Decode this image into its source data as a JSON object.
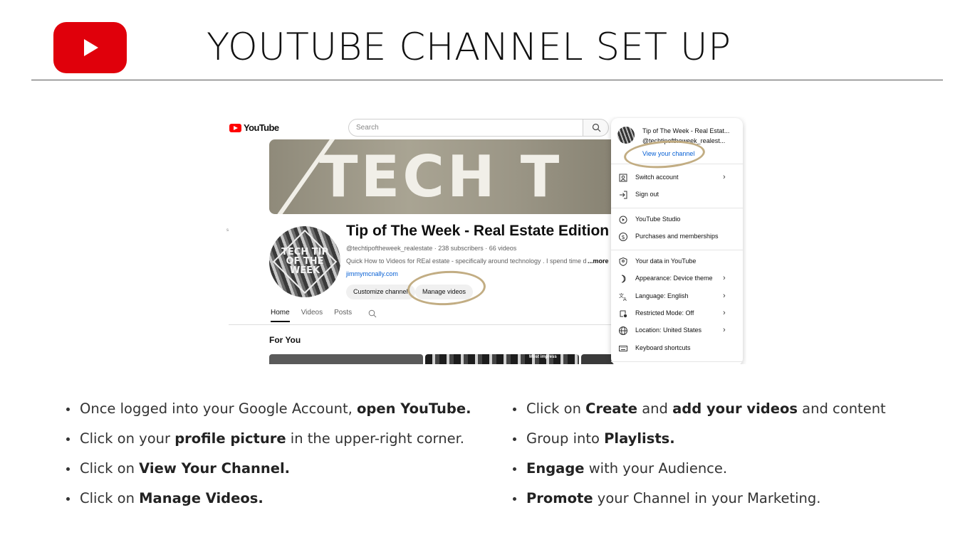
{
  "slide": {
    "title": "YOUTUBE CHANNEL SET UP",
    "logo_icon": "youtube-play-icon",
    "accent_color": "#e0000b"
  },
  "screenshot": {
    "brand": "YouTube",
    "search_placeholder": "Search",
    "banner_text": "TECH T",
    "avatar_text": [
      "TECH TIP",
      "OF THE",
      "WEEK"
    ],
    "channel": {
      "name": "Tip of The Week - Real Estate Edition",
      "meta": "@techtipoftheweek_realestate · 238 subscribers · 66 videos",
      "description": "Quick How to Videos for REal estate - specifically around technology . I spend time disc",
      "more": "...more",
      "link": "jimmymcnally.com",
      "customize_label": "Customize channel",
      "manage_label": "Manage videos"
    },
    "tabs": [
      "Home",
      "Videos",
      "Posts"
    ],
    "section_title": "For You",
    "thumb_caption": "Most impress",
    "stray_mark": "s",
    "menu": {
      "account_name": "Tip of The Week - Real Estat...",
      "account_handle": "@techtipoftheweek_realest...",
      "view_channel": "View your channel",
      "items": [
        {
          "label": "Switch account",
          "icon": "switch-account-icon",
          "chevron": true
        },
        {
          "label": "Sign out",
          "icon": "sign-out-icon",
          "chevron": false
        },
        {
          "label": "YouTube Studio",
          "icon": "studio-icon",
          "chevron": false
        },
        {
          "label": "Purchases and memberships",
          "icon": "dollar-icon",
          "chevron": false
        },
        {
          "label": "Your data in YouTube",
          "icon": "shield-icon",
          "chevron": false
        },
        {
          "label": "Appearance: Device theme",
          "icon": "moon-icon",
          "chevron": true
        },
        {
          "label": "Language: English",
          "icon": "translate-icon",
          "chevron": true
        },
        {
          "label": "Restricted Mode: Off",
          "icon": "restricted-icon",
          "chevron": true
        },
        {
          "label": "Location: United States",
          "icon": "globe-icon",
          "chevron": true
        },
        {
          "label": "Keyboard shortcuts",
          "icon": "keyboard-icon",
          "chevron": false
        }
      ]
    }
  },
  "steps_left": [
    [
      {
        "t": "Once logged into your Google Account, "
      },
      {
        "t": "open YouTube.",
        "b": true
      }
    ],
    [
      {
        "t": "Click on your "
      },
      {
        "t": "profile picture",
        "b": true
      },
      {
        "t": " in the upper-right corner."
      }
    ],
    [
      {
        "t": "Click on "
      },
      {
        "t": "View Your Channel.",
        "b": true
      }
    ],
    [
      {
        "t": "Click on "
      },
      {
        "t": "Manage Videos.",
        "b": true
      }
    ]
  ],
  "steps_right": [
    [
      {
        "t": "Click on "
      },
      {
        "t": "Create",
        "b": true
      },
      {
        "t": " and "
      },
      {
        "t": "add your videos",
        "b": true
      },
      {
        "t": " and content"
      }
    ],
    [
      {
        "t": "Group into "
      },
      {
        "t": "Playlists.",
        "b": true
      }
    ],
    [
      {
        "t": "Engage",
        "b": true
      },
      {
        "t": " with your Audience."
      }
    ],
    [
      {
        "t": "Promote",
        "b": true
      },
      {
        "t": " your Channel in your Marketing."
      }
    ]
  ]
}
